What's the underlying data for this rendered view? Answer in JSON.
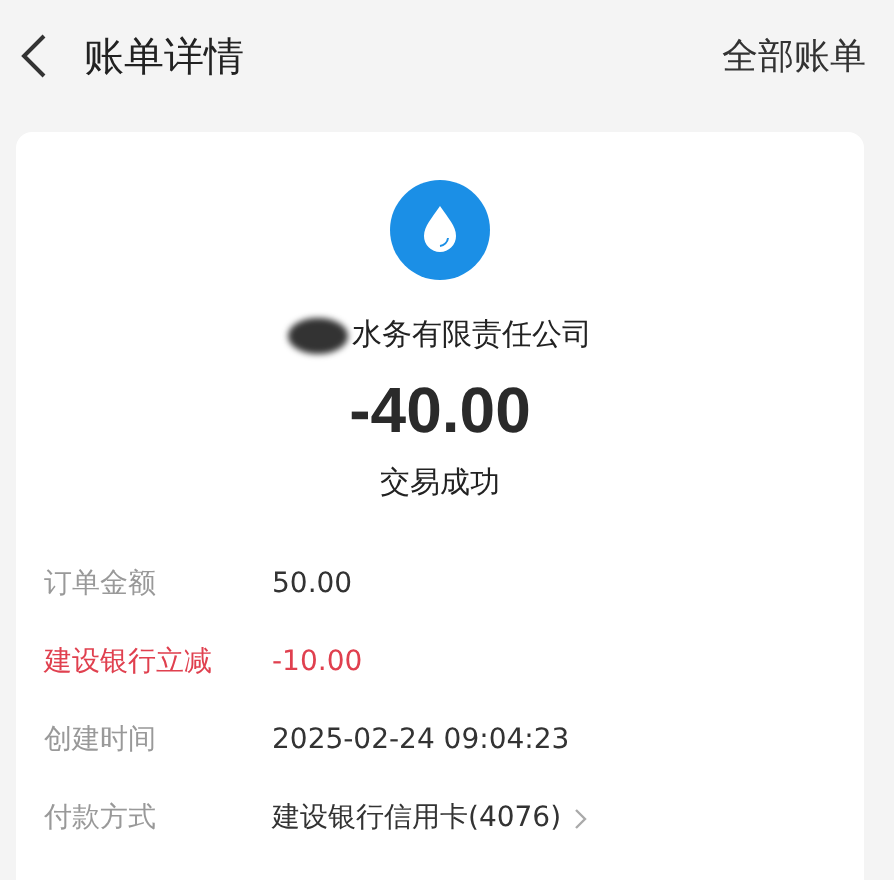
{
  "header": {
    "title": "账单详情",
    "action": "全部账单"
  },
  "merchant": {
    "name": "水务有限责任公司",
    "redacted": true
  },
  "amount": "-40.00",
  "status": "交易成功",
  "details": [
    {
      "kind": "plain",
      "label": "订单金额",
      "value": "50.00"
    },
    {
      "kind": "discount",
      "label": "建设银行立减",
      "value": "-10.00"
    },
    {
      "kind": "plain",
      "label": "创建时间",
      "value": "2025-02-24 09:04:23"
    },
    {
      "kind": "link",
      "label": "付款方式",
      "value": "建设银行信用卡(4076)"
    }
  ]
}
